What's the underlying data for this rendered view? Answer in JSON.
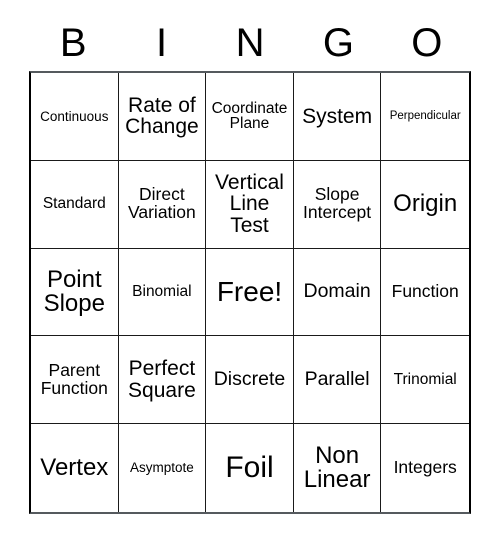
{
  "card": {
    "title": "BINGO",
    "free_space_label": "Free!",
    "header": {
      "letters": [
        "B",
        "I",
        "N",
        "G",
        "O"
      ]
    },
    "grid": {
      "rows": 5,
      "columns": 5,
      "cells": [
        {
          "label": "Continuous",
          "size": "fs-13"
        },
        {
          "label": "Rate of\nChange",
          "size": "fs-21"
        },
        {
          "label": "Coordinate\nPlane",
          "size": "fs-15"
        },
        {
          "label": "System",
          "size": "fs-21"
        },
        {
          "label": "Perpendicular",
          "size": "fs-11"
        },
        {
          "label": "Standard",
          "size": "fs-15"
        },
        {
          "label": "Direct\nVariation",
          "size": "fs-17"
        },
        {
          "label": "Vertical\nLine\nTest",
          "size": "fs-21"
        },
        {
          "label": "Slope\nIntercept",
          "size": "fs-17"
        },
        {
          "label": "Origin",
          "size": "fs-24"
        },
        {
          "label": "Point\nSlope",
          "size": "fs-24"
        },
        {
          "label": "Binomial",
          "size": "fs-15"
        },
        {
          "label": "Free!",
          "size": "fs-28"
        },
        {
          "label": "Domain",
          "size": "fs-19"
        },
        {
          "label": "Function",
          "size": "fs-17"
        },
        {
          "label": "Parent\nFunction",
          "size": "fs-17"
        },
        {
          "label": "Perfect\nSquare",
          "size": "fs-21"
        },
        {
          "label": "Discrete",
          "size": "fs-19"
        },
        {
          "label": "Parallel",
          "size": "fs-19"
        },
        {
          "label": "Trinomial",
          "size": "fs-15"
        },
        {
          "label": "Vertex",
          "size": "fs-24"
        },
        {
          "label": "Asymptote",
          "size": "fs-13"
        },
        {
          "label": "Foil",
          "size": "fs-30"
        },
        {
          "label": "Non\nLinear",
          "size": "fs-24"
        },
        {
          "label": "Integers",
          "size": "fs-17"
        }
      ]
    },
    "colors": {
      "background": "#ffffff",
      "cell_background": "#ffffff",
      "border": "#1a1a1a",
      "text": "#000000"
    }
  }
}
